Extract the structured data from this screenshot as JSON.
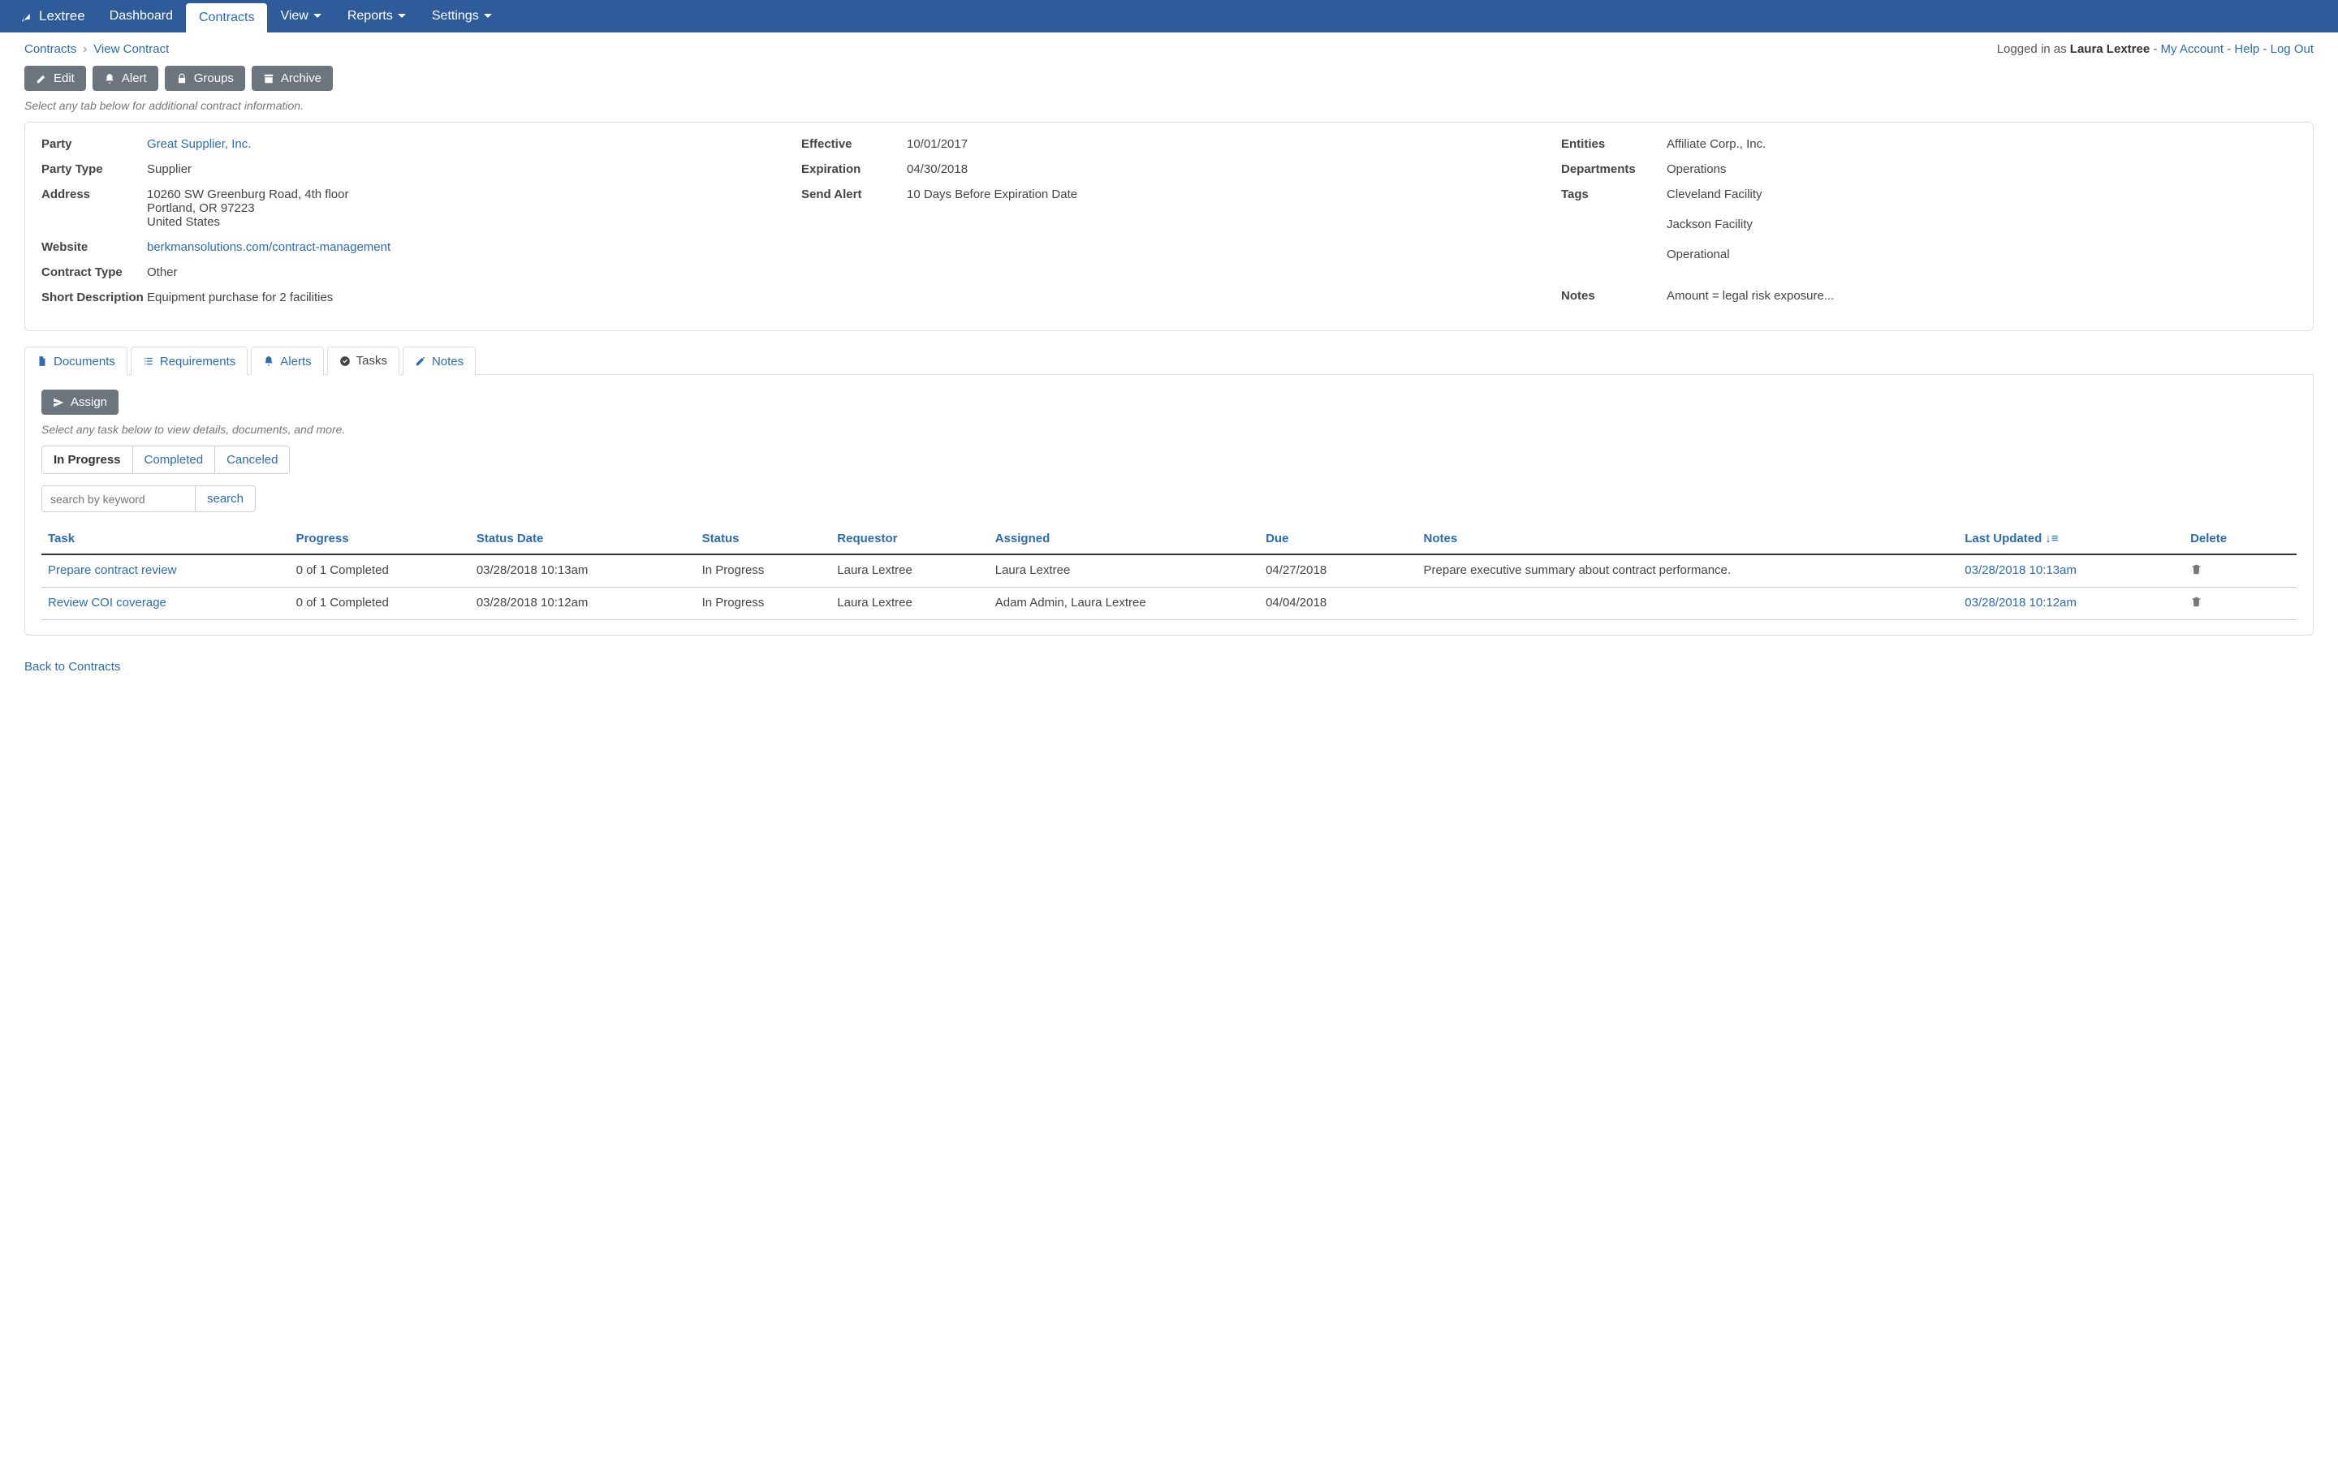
{
  "brand": "Lextree",
  "nav": {
    "dashboard": "Dashboard",
    "contracts": "Contracts",
    "view": "View",
    "reports": "Reports",
    "settings": "Settings"
  },
  "breadcrumb": {
    "root": "Contracts",
    "current": "View Contract"
  },
  "userbar": {
    "prefix": "Logged in as ",
    "name": "Laura Lextree",
    "account": "My Account",
    "help": "Help",
    "logout": "Log Out"
  },
  "actions": {
    "edit": "Edit",
    "alert": "Alert",
    "groups": "Groups",
    "archive": "Archive"
  },
  "hint_tabs": "Select any tab below for additional contract information.",
  "details": {
    "col1": {
      "party_label": "Party",
      "party_value": "Great Supplier, Inc.",
      "partytype_label": "Party Type",
      "partytype_value": "Supplier",
      "address_label": "Address",
      "address_l1": "10260 SW Greenburg Road, 4th floor",
      "address_l2": "Portland, OR 97223",
      "address_l3": "United States",
      "website_label": "Website",
      "website_value": "berkmansolutions.com/contract-management",
      "ctype_label": "Contract Type",
      "ctype_value": "Other",
      "shortdesc_label": "Short Description",
      "shortdesc_value": "Equipment purchase for 2 facilities"
    },
    "col2": {
      "effective_label": "Effective",
      "effective_value": "10/01/2017",
      "expiration_label": "Expiration",
      "expiration_value": "04/30/2018",
      "sendalert_label": "Send Alert",
      "sendalert_value": "10 Days Before Expiration Date"
    },
    "col3": {
      "entities_label": "Entities",
      "entities_value": "Affiliate Corp., Inc.",
      "depts_label": "Departments",
      "depts_value": "Operations",
      "tags_label": "Tags",
      "tag1": "Cleveland Facility",
      "tag2": "Jackson Facility",
      "tag3": "Operational",
      "notes_label": "Notes",
      "notes_value": "Amount = legal risk exposure..."
    }
  },
  "tabs": {
    "documents": "Documents",
    "requirements": "Requirements",
    "alerts": "Alerts",
    "tasks": "Tasks",
    "notes": "Notes"
  },
  "tasks": {
    "assign": "Assign",
    "hint": "Select any task below to view details, documents, and more.",
    "filters": {
      "inprogress": "In Progress",
      "completed": "Completed",
      "canceled": "Canceled"
    },
    "search_placeholder": "search by keyword",
    "search_btn": "search",
    "headers": {
      "task": "Task",
      "progress": "Progress",
      "statusdate": "Status Date",
      "status": "Status",
      "requestor": "Requestor",
      "assigned": "Assigned",
      "due": "Due",
      "notes": "Notes",
      "lastupdated": "Last Updated",
      "delete": "Delete"
    },
    "rows": [
      {
        "task": "Prepare contract review",
        "progress": "0 of 1 Completed",
        "statusdate": "03/28/2018 10:13am",
        "status": "In Progress",
        "requestor": "Laura Lextree",
        "assigned": "Laura Lextree",
        "due": "04/27/2018",
        "notes": "Prepare executive summary about contract performance.",
        "lastupdated": "03/28/2018 10:13am"
      },
      {
        "task": "Review COI coverage",
        "progress": "0 of 1 Completed",
        "statusdate": "03/28/2018 10:12am",
        "status": "In Progress",
        "requestor": "Laura Lextree",
        "assigned": "Adam Admin, Laura Lextree",
        "due": "04/04/2018",
        "notes": "",
        "lastupdated": "03/28/2018 10:12am"
      }
    ]
  },
  "backlink": "Back to Contracts"
}
